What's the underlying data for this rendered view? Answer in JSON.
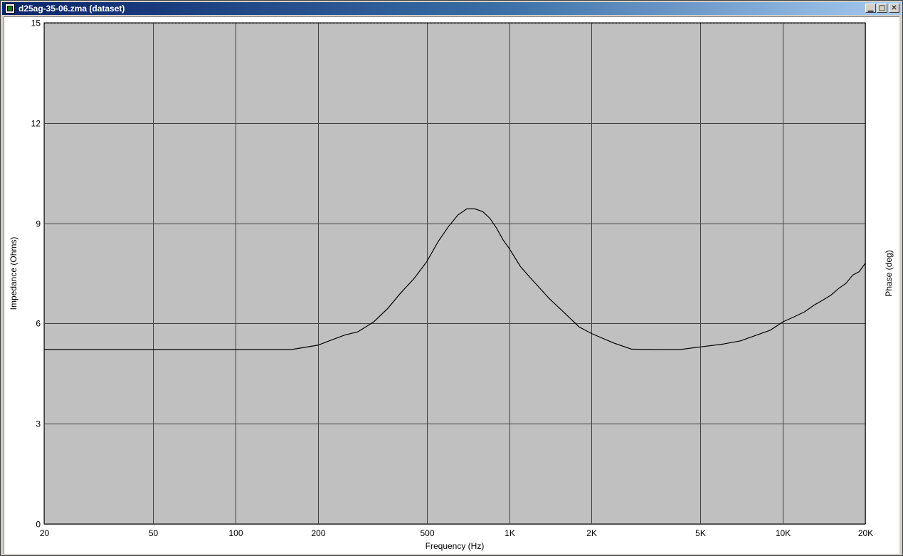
{
  "window": {
    "title": "d25ag-35-06.zma (dataset)",
    "minimize_glyph": "▁",
    "maximize_glyph": "□",
    "close_glyph": "✕",
    "icon": "app-icon"
  },
  "colors": {
    "plot_background": "#c0c0c0",
    "grid": "#404040",
    "curve": "#000000",
    "page_background": "#ffffff"
  },
  "chart_data": {
    "type": "line",
    "title": "",
    "xlabel": "Frequency (Hz)",
    "ylabel": "Impedance (Ohms)",
    "y2label": "Phase (deg)",
    "xscale": "log",
    "xlim": [
      20,
      20000
    ],
    "ylim": [
      0,
      15
    ],
    "grid": true,
    "x_ticks": [
      20,
      50,
      100,
      200,
      500,
      1000,
      2000,
      5000,
      10000,
      20000
    ],
    "x_tick_labels": [
      "20",
      "50",
      "100",
      "200",
      "500",
      "1K",
      "2K",
      "5K",
      "10K",
      "20K"
    ],
    "y_ticks": [
      0,
      3,
      6,
      9,
      12,
      15
    ],
    "y_tick_labels": [
      "0",
      "3",
      "6",
      "9",
      "12",
      "15"
    ],
    "series": [
      {
        "x": [
          20,
          50,
          100,
          160,
          200,
          220,
          250,
          280,
          320,
          360,
          400,
          450,
          500,
          550,
          600,
          650,
          700,
          750,
          800,
          850,
          900,
          950,
          1000,
          1100,
          1200,
          1400,
          1600,
          1800,
          2000,
          2400,
          2800,
          3500,
          4200,
          5000,
          6000,
          7000,
          8000,
          9000,
          10000,
          11000,
          12000,
          13000,
          14000,
          15000,
          16000,
          17000,
          18000,
          19000,
          20000
        ],
        "y": [
          5.22,
          5.22,
          5.22,
          5.22,
          5.35,
          5.48,
          5.65,
          5.75,
          6.05,
          6.45,
          6.9,
          7.35,
          7.85,
          8.45,
          8.9,
          9.25,
          9.43,
          9.43,
          9.35,
          9.15,
          8.85,
          8.5,
          8.25,
          7.7,
          7.35,
          6.75,
          6.3,
          5.9,
          5.7,
          5.42,
          5.23,
          5.22,
          5.22,
          5.3,
          5.38,
          5.48,
          5.65,
          5.8,
          6.05,
          6.2,
          6.35,
          6.55,
          6.7,
          6.85,
          7.05,
          7.2,
          7.45,
          7.55,
          7.8
        ]
      }
    ]
  }
}
